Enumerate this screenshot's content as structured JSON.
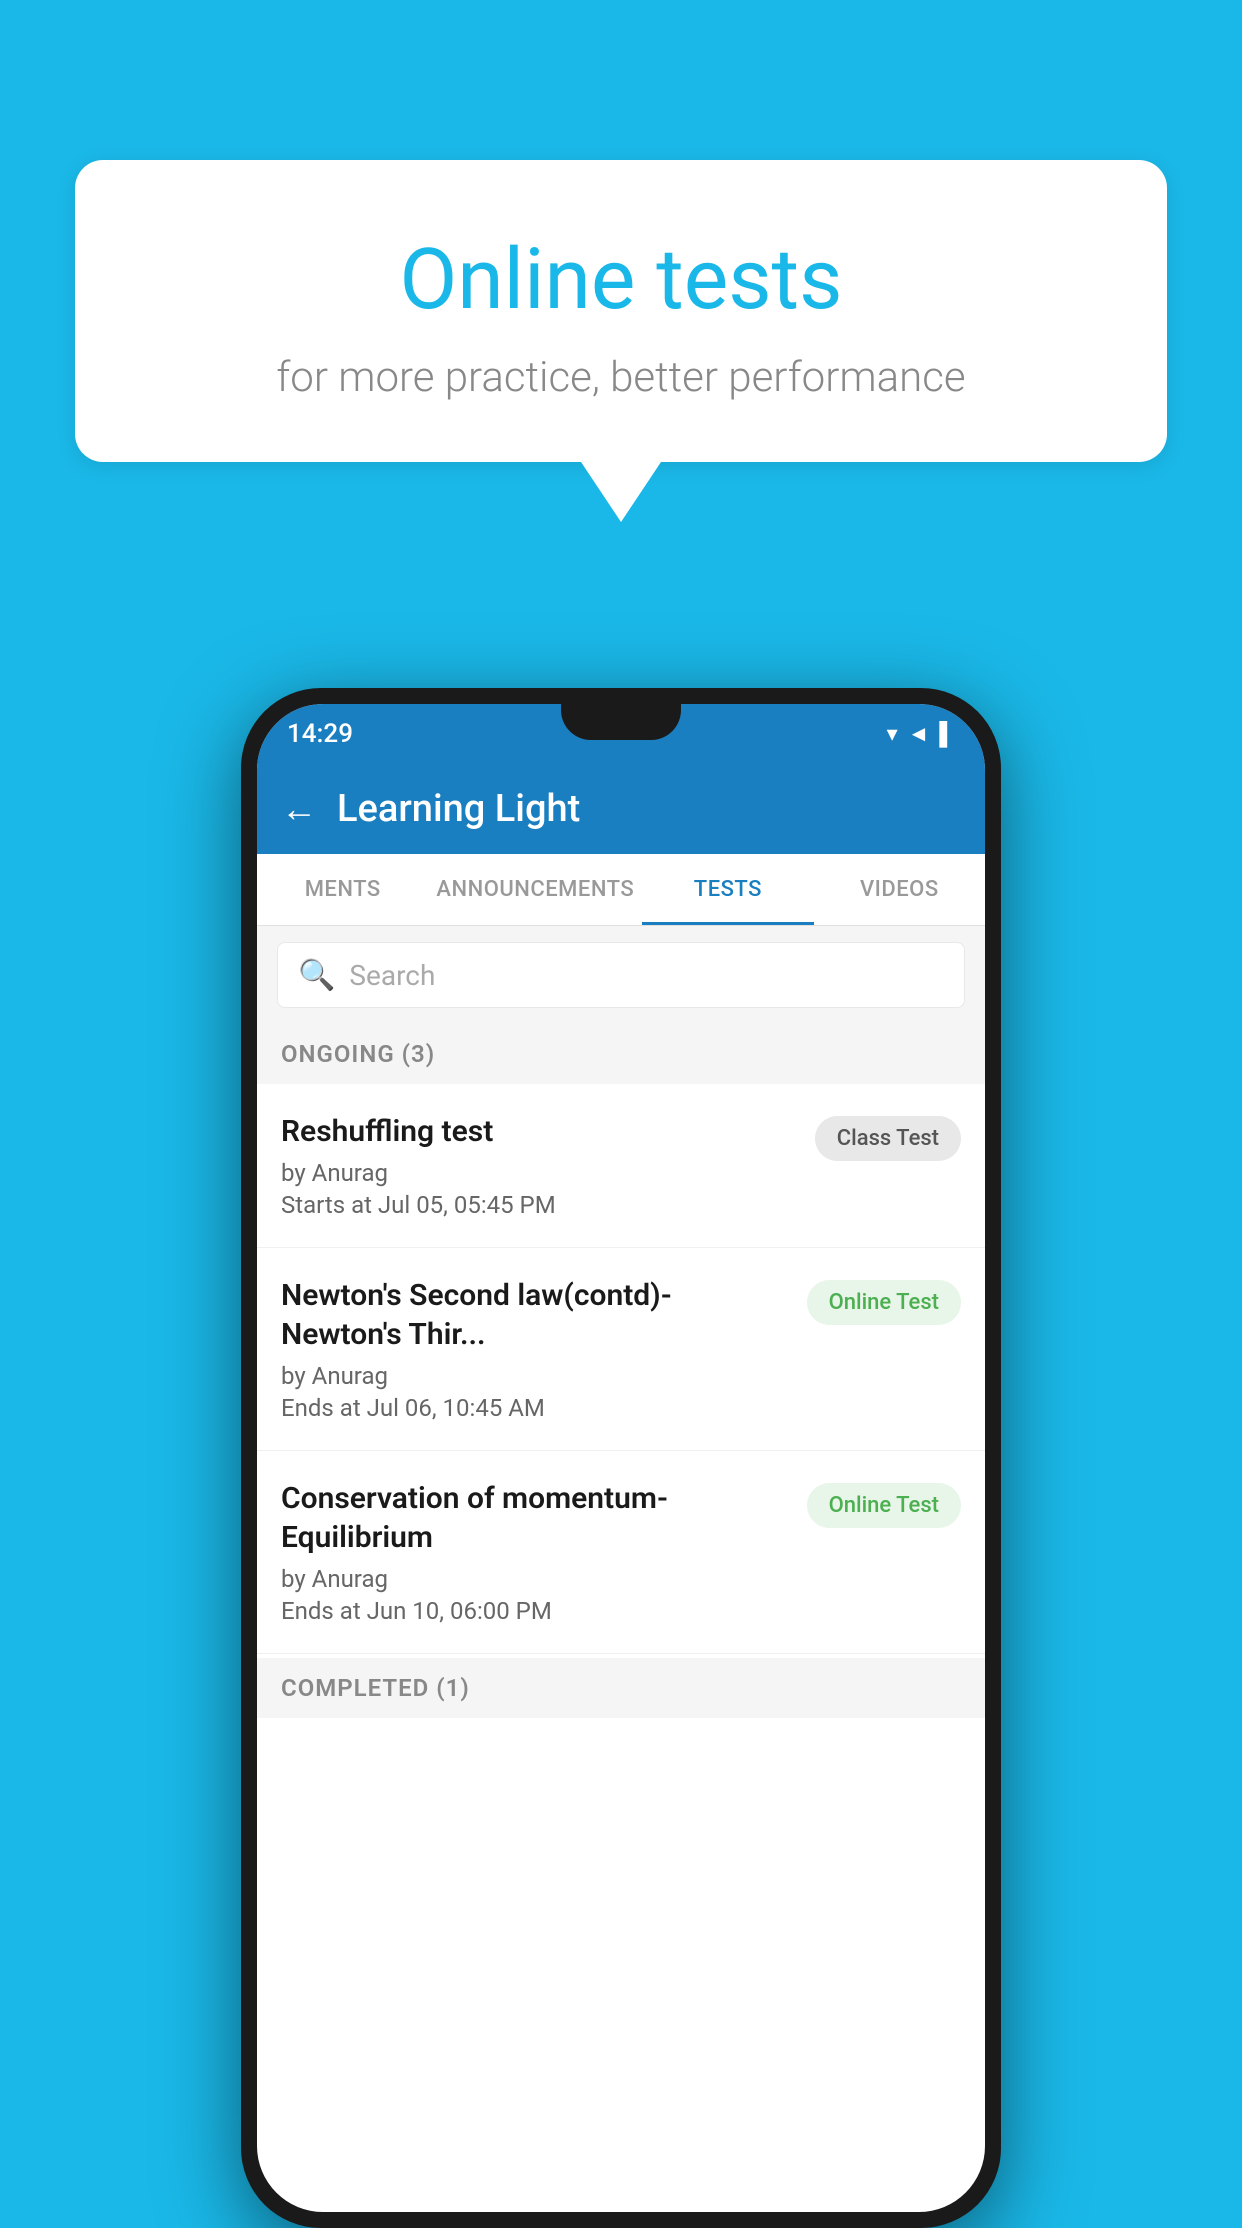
{
  "background_color": "#1ab8e8",
  "bubble": {
    "title": "Online tests",
    "subtitle": "for more practice, better performance"
  },
  "phone": {
    "status_bar": {
      "time": "14:29",
      "icons": "▼◄▌"
    },
    "app_bar": {
      "title": "Learning Light",
      "back_label": "←"
    },
    "tabs": [
      {
        "label": "MENTS",
        "active": false
      },
      {
        "label": "ANNOUNCEMENTS",
        "active": false
      },
      {
        "label": "TESTS",
        "active": true
      },
      {
        "label": "VIDEOS",
        "active": false
      }
    ],
    "search": {
      "placeholder": "Search"
    },
    "ongoing_section": {
      "label": "ONGOING (3)"
    },
    "tests": [
      {
        "name": "Reshuffling test",
        "author": "by Anurag",
        "time": "Starts at  Jul 05, 05:45 PM",
        "tag": "Class Test",
        "tag_type": "class"
      },
      {
        "name": "Newton's Second law(contd)-Newton's Thir...",
        "author": "by Anurag",
        "time": "Ends at  Jul 06, 10:45 AM",
        "tag": "Online Test",
        "tag_type": "online"
      },
      {
        "name": "Conservation of momentum-Equilibrium",
        "author": "by Anurag",
        "time": "Ends at  Jun 10, 06:00 PM",
        "tag": "Online Test",
        "tag_type": "online"
      }
    ],
    "completed_section": {
      "label": "COMPLETED (1)"
    }
  }
}
